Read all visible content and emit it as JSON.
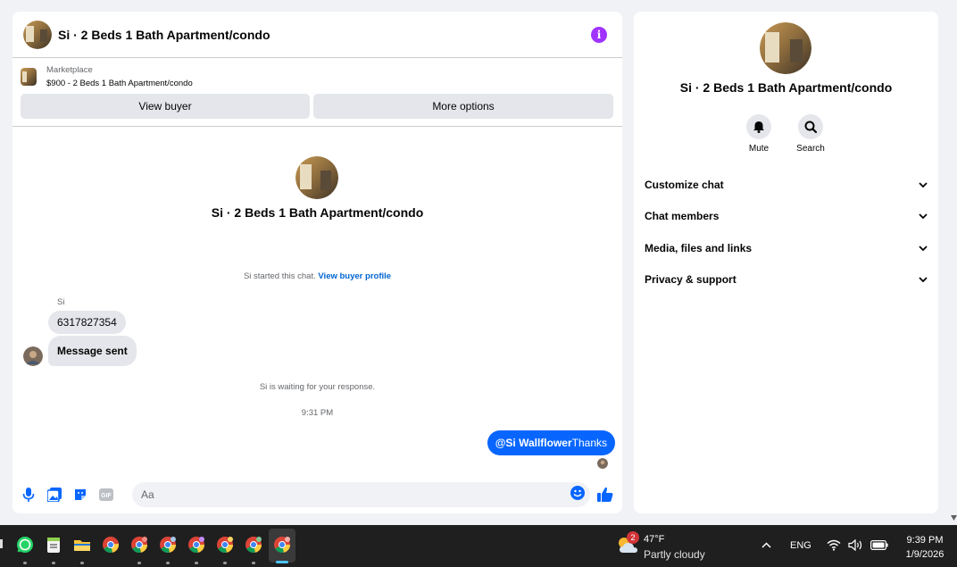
{
  "chat": {
    "title": "Si · 2 Beds 1 Bath Apartment/condo",
    "marketplace_label": "Marketplace",
    "listing": "$900 - 2 Beds 1 Bath Apartment/condo",
    "view_buyer": "View buyer",
    "more_options": "More options"
  },
  "thread": {
    "title": "Si · 2 Beds 1 Bath Apartment/condo",
    "started_text": "Si started this chat.",
    "view_profile": "View buyer profile",
    "sender_name": "Si",
    "messages_in": [
      "6317827354",
      "Message sent"
    ],
    "waiting": "Si is waiting for your response.",
    "time": "9:31 PM",
    "outgoing_mention": "@Si Wallflower",
    "outgoing_text": "Thanks"
  },
  "composer": {
    "placeholder": "Aa"
  },
  "side": {
    "title": "Si · 2 Beds 1 Bath Apartment/condo",
    "mute": "Mute",
    "search": "Search",
    "menu": [
      "Customize chat",
      "Chat members",
      "Media, files and links",
      "Privacy & support"
    ]
  },
  "taskbar": {
    "weather_badge": "2",
    "temperature": "47°F",
    "weather": "Partly cloudy",
    "language": "ENG",
    "time": "9:39 PM",
    "date": "1/9/2026"
  },
  "colors": {
    "accent": "#0866ff",
    "info": "#a033ff",
    "bubble_in": "#e4e6eb",
    "taskbar": "#1f1f1f"
  }
}
